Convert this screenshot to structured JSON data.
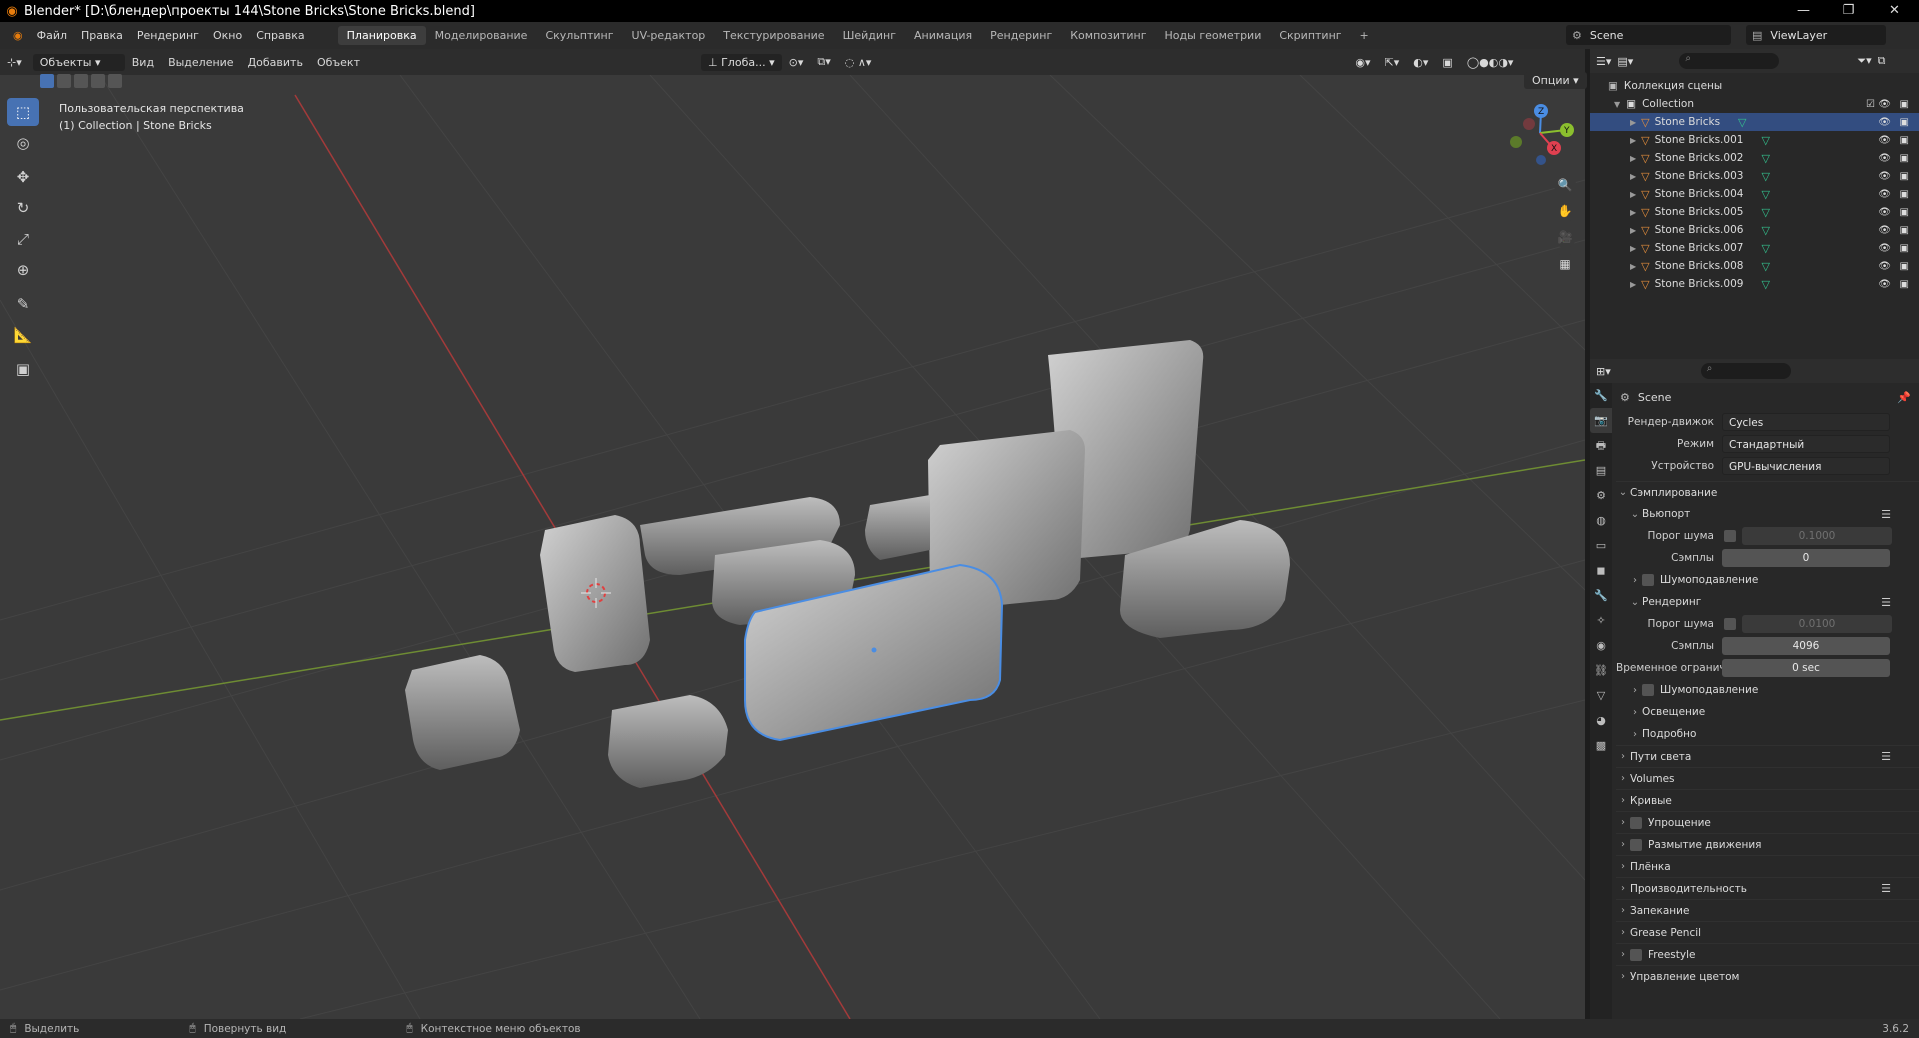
{
  "window": {
    "title": "Blender* [D:\\блендер\\проекты 144\\Stone Bricks\\Stone Bricks.blend]",
    "minimize_icon": "minimize-icon",
    "maximize_icon": "restore-icon",
    "close_icon": "close-icon"
  },
  "topbar": {
    "menus": [
      "Файл",
      "Правка",
      "Рендеринг",
      "Окно",
      "Справка"
    ],
    "workspaces": [
      "Планировка",
      "Моделирование",
      "Скульптинг",
      "UV-редактор",
      "Текстурирование",
      "Шейдинг",
      "Анимация",
      "Рендеринг",
      "Композитинг",
      "Ноды геометрии",
      "Скриптинг"
    ],
    "active_workspace": "Планировка",
    "add_workspace": "+",
    "scene": "Scene",
    "view_layer": "ViewLayer"
  },
  "viewport_header": {
    "mode": "Объекты",
    "menus": [
      "Вид",
      "Выделение",
      "Добавить",
      "Объект"
    ],
    "transform_orientation": "Глоба...",
    "options": "Опции"
  },
  "viewport": {
    "view_name": "Пользовательская перспектива",
    "object_info": "(1) Collection | Stone Bricks",
    "gizmo_labels": [
      "Z",
      "Y",
      "X"
    ]
  },
  "toolbar": {
    "tools": [
      "select-box-icon",
      "cursor-icon",
      "move-icon",
      "rotate-icon",
      "scale-icon",
      "transform-icon",
      "annotate-icon",
      "measure-icon",
      "add-cube-icon"
    ]
  },
  "outliner": {
    "scene_collection": "Коллекция сцены",
    "collection": "Collection",
    "objects": [
      "Stone Bricks",
      "Stone Bricks.001",
      "Stone Bricks.002",
      "Stone Bricks.003",
      "Stone Bricks.004",
      "Stone Bricks.005",
      "Stone Bricks.006",
      "Stone Bricks.007",
      "Stone Bricks.008",
      "Stone Bricks.009"
    ],
    "selected_object": "Stone Bricks"
  },
  "properties": {
    "scene_name": "Scene",
    "render_engine_label": "Рендер-движок",
    "render_engine": "Cycles",
    "mode_label": "Режим",
    "mode": "Стандартный",
    "device_label": "Устройство",
    "device": "GPU-вычисления",
    "sampling": "Сэмплирование",
    "viewport": "Вьюпорт",
    "noise_threshold_label": "Порог шума",
    "viewport_noise_threshold": "0.1000",
    "samples_label": "Сэмплы",
    "viewport_samples": "0",
    "denoise": "Шумоподавление",
    "render": "Рендеринг",
    "render_noise_threshold": "0.0100",
    "render_samples": "4096",
    "time_limit_label": "Временное огранич...",
    "time_limit": "0 sec",
    "lights": "Освещение",
    "advanced": "Подробно",
    "panels": [
      "Пути света",
      "Volumes",
      "Кривые",
      "Упрощение",
      "Размытие движения",
      "Плёнка",
      "Производительность",
      "Запекание",
      "Grease Pencil",
      "Freestyle",
      "Управление цветом"
    ]
  },
  "statusbar": {
    "select": "Выделить",
    "rotate_view": "Повернуть вид",
    "context_menu": "Контекстное меню объектов",
    "version": "3.6.2"
  }
}
